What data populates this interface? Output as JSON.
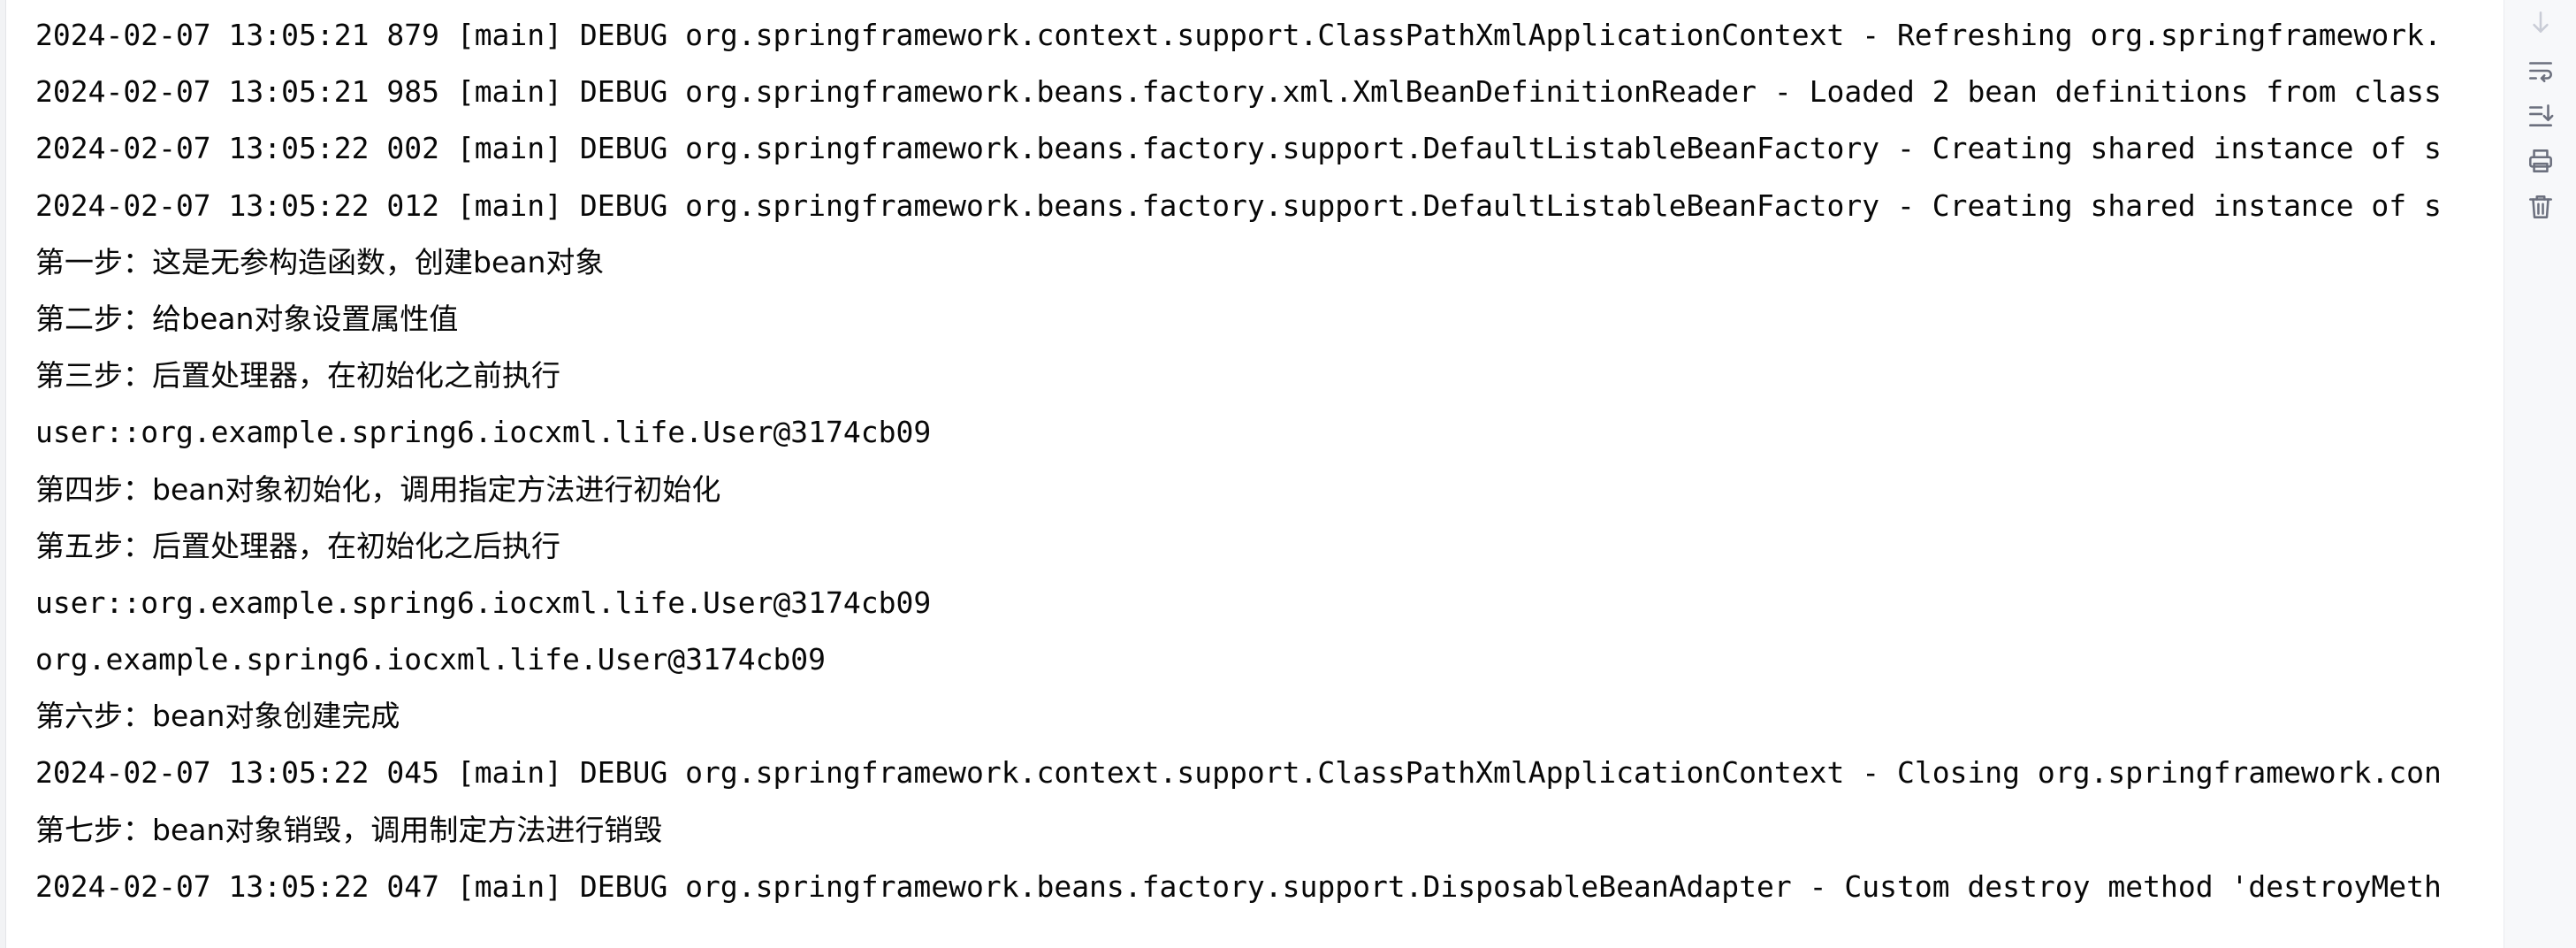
{
  "console": {
    "lines": [
      {
        "text": "2024-02-07 13:05:21 879 [main] DEBUG org.springframework.context.support.ClassPathXmlApplicationContext - Refreshing org.springframework.",
        "kind": "log"
      },
      {
        "text": "2024-02-07 13:05:21 985 [main] DEBUG org.springframework.beans.factory.xml.XmlBeanDefinitionReader - Loaded 2 bean definitions from class",
        "kind": "log"
      },
      {
        "text": "2024-02-07 13:05:22 002 [main] DEBUG org.springframework.beans.factory.support.DefaultListableBeanFactory - Creating shared instance of s",
        "kind": "log"
      },
      {
        "text": "2024-02-07 13:05:22 012 [main] DEBUG org.springframework.beans.factory.support.DefaultListableBeanFactory - Creating shared instance of s",
        "kind": "log"
      },
      {
        "text": "第一步：这是无参构造函数，创建bean对象",
        "kind": "cn"
      },
      {
        "text": "第二步：给bean对象设置属性值",
        "kind": "cn"
      },
      {
        "text": "第三步：后置处理器，在初始化之前执行",
        "kind": "cn"
      },
      {
        "text": "user::org.example.spring6.iocxml.life.User@3174cb09",
        "kind": "log"
      },
      {
        "text": "第四步：bean对象初始化，调用指定方法进行初始化",
        "kind": "cn"
      },
      {
        "text": "第五步：后置处理器，在初始化之后执行",
        "kind": "cn"
      },
      {
        "text": "user::org.example.spring6.iocxml.life.User@3174cb09",
        "kind": "log"
      },
      {
        "text": "org.example.spring6.iocxml.life.User@3174cb09",
        "kind": "log"
      },
      {
        "text": "第六步：bean对象创建完成",
        "kind": "cn"
      },
      {
        "text": "2024-02-07 13:05:22 045 [main] DEBUG org.springframework.context.support.ClassPathXmlApplicationContext - Closing org.springframework.con",
        "kind": "log"
      },
      {
        "text": "第七步：bean对象销毁，调用制定方法进行销毁",
        "kind": "cn"
      },
      {
        "text": "2024-02-07 13:05:22 047 [main] DEBUG org.springframework.beans.factory.support.DisposableBeanAdapter - Custom destroy method 'destroyMeth",
        "kind": "log"
      }
    ]
  },
  "toolbar": {
    "icons": [
      "scroll-down-icon",
      "soft-wrap-icon",
      "scroll-to-end-icon",
      "print-icon",
      "clear-all-icon"
    ]
  },
  "colors": {
    "text": "#080808",
    "background": "#ffffff",
    "toolbar_bg": "#f7f8fa",
    "icon": "#6c707e"
  }
}
